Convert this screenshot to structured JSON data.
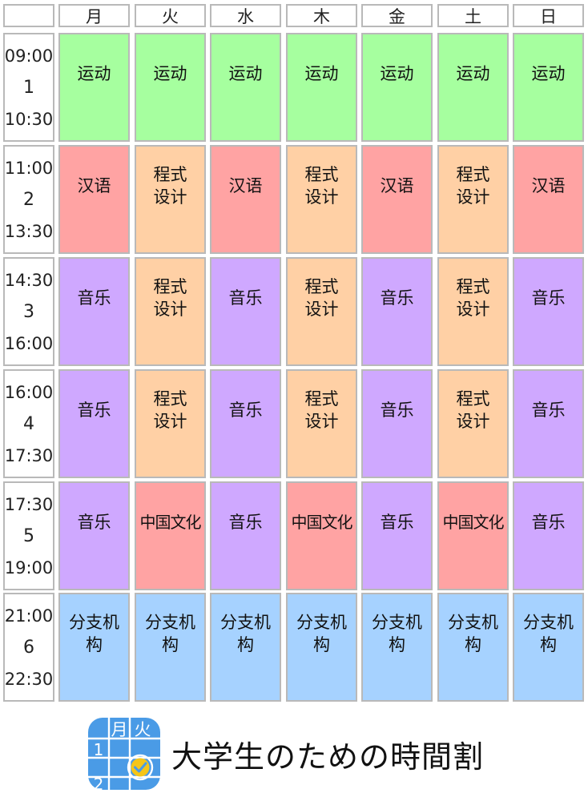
{
  "timetable": {
    "days": [
      "月",
      "火",
      "水",
      "木",
      "金",
      "土",
      "日"
    ],
    "periods": [
      {
        "number": "1",
        "start": "09:00",
        "end": "10:30"
      },
      {
        "number": "2",
        "start": "11:00",
        "end": "13:30"
      },
      {
        "number": "3",
        "start": "14:30",
        "end": "16:00"
      },
      {
        "number": "4",
        "start": "16:00",
        "end": "17:30"
      },
      {
        "number": "5",
        "start": "17:30",
        "end": "19:00"
      },
      {
        "number": "6",
        "start": "21:00",
        "end": "22:30"
      }
    ],
    "cells": [
      [
        {
          "name": "运动",
          "color": "#a6ff9f"
        },
        {
          "name": "运动",
          "color": "#a6ff9f"
        },
        {
          "name": "运动",
          "color": "#a6ff9f"
        },
        {
          "name": "运动",
          "color": "#a6ff9f"
        },
        {
          "name": "运动",
          "color": "#a6ff9f"
        },
        {
          "name": "运动",
          "color": "#a6ff9f"
        },
        {
          "name": "运动",
          "color": "#a6ff9f"
        }
      ],
      [
        {
          "name": "汉语",
          "color": "#ffa3a3"
        },
        {
          "name": "程式设计",
          "color": "#ffd0a5"
        },
        {
          "name": "汉语",
          "color": "#ffa3a3"
        },
        {
          "name": "程式设计",
          "color": "#ffd0a5"
        },
        {
          "name": "汉语",
          "color": "#ffa3a3"
        },
        {
          "name": "程式设计",
          "color": "#ffd0a5"
        },
        {
          "name": "汉语",
          "color": "#ffa3a3"
        }
      ],
      [
        {
          "name": "音乐",
          "color": "#cfa8ff"
        },
        {
          "name": "程式设计",
          "color": "#ffd0a5"
        },
        {
          "name": "音乐",
          "color": "#cfa8ff"
        },
        {
          "name": "程式设计",
          "color": "#ffd0a5"
        },
        {
          "name": "音乐",
          "color": "#cfa8ff"
        },
        {
          "name": "程式设计",
          "color": "#ffd0a5"
        },
        {
          "name": "音乐",
          "color": "#cfa8ff"
        }
      ],
      [
        {
          "name": "音乐",
          "color": "#cfa8ff"
        },
        {
          "name": "程式设计",
          "color": "#ffd0a5"
        },
        {
          "name": "音乐",
          "color": "#cfa8ff"
        },
        {
          "name": "程式设计",
          "color": "#ffd0a5"
        },
        {
          "name": "音乐",
          "color": "#cfa8ff"
        },
        {
          "name": "程式设计",
          "color": "#ffd0a5"
        },
        {
          "name": "音乐",
          "color": "#cfa8ff"
        }
      ],
      [
        {
          "name": "音乐",
          "color": "#cfa8ff"
        },
        {
          "name": "中国文化",
          "color": "#ffa3a3"
        },
        {
          "name": "音乐",
          "color": "#cfa8ff"
        },
        {
          "name": "中国文化",
          "color": "#ffa3a3"
        },
        {
          "name": "音乐",
          "color": "#cfa8ff"
        },
        {
          "name": "中国文化",
          "color": "#ffa3a3"
        },
        {
          "name": "音乐",
          "color": "#cfa8ff"
        }
      ],
      [
        {
          "name": "分支机构",
          "color": "#a6d2ff"
        },
        {
          "name": "分支机构",
          "color": "#a6d2ff"
        },
        {
          "name": "分支机构",
          "color": "#a6d2ff"
        },
        {
          "name": "分支机构",
          "color": "#a6d2ff"
        },
        {
          "name": "分支机构",
          "color": "#a6d2ff"
        },
        {
          "name": "分支机构",
          "color": "#a6d2ff"
        },
        {
          "name": "分支机构",
          "color": "#a6d2ff"
        }
      ]
    ]
  },
  "footer": {
    "app_name": "大学生のための時間割",
    "icon_name": "calendar-check-icon",
    "icon_glyphs": {
      "day1": "月",
      "day2": "火",
      "row1": "1",
      "row2": "2"
    },
    "icon_color": "#4a9be6",
    "icon_check_color": "#f5c518"
  }
}
